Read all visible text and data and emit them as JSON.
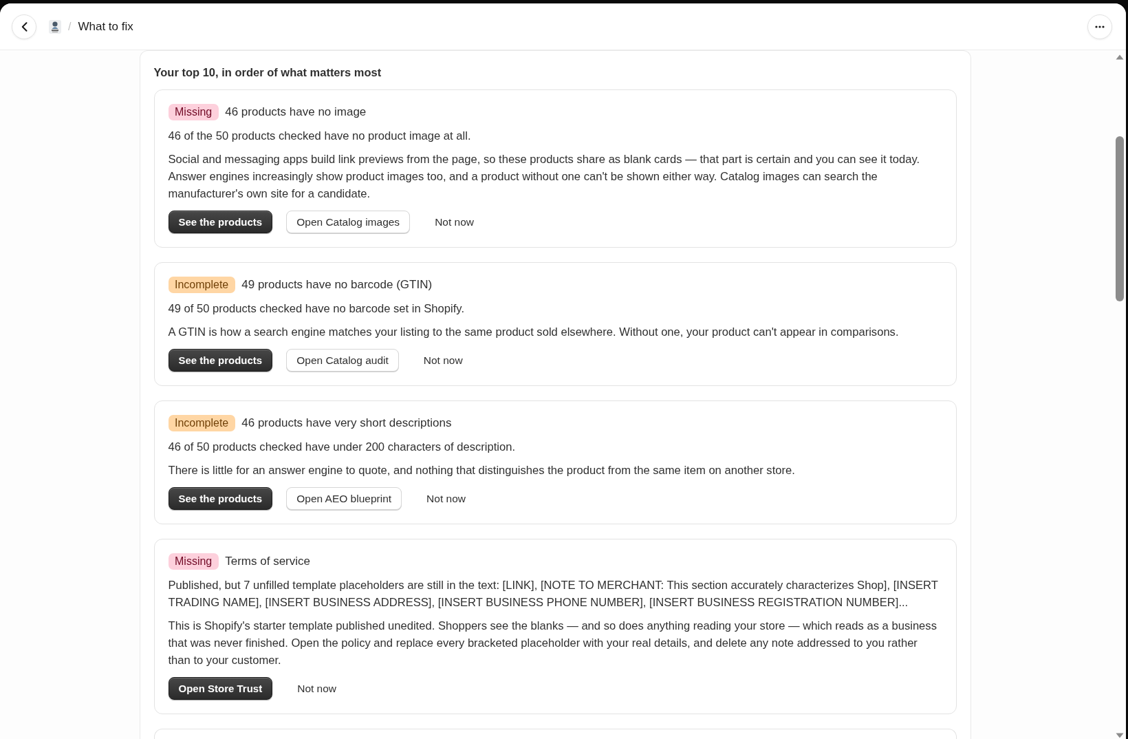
{
  "header": {
    "breadcrumb": {
      "separator": "/",
      "title": "What to fix"
    }
  },
  "panel": {
    "heading": "Your top 10, in order of what matters most",
    "issues": [
      {
        "badge": {
          "label": "Missing",
          "color": "#fdd0dc"
        },
        "title": "46 products have no image",
        "summary": "46 of the 50 products checked have no product image at all.",
        "detail": "Social and messaging apps build link previews from the page, so these products share as blank cards — that part is certain and you can see it today. Answer engines increasingly show product images too, and a product without one can't be shown either way. Catalog images can search the manufacturer's own site for a candidate.",
        "actions": [
          {
            "label": "See the products",
            "kind": "primary"
          },
          {
            "label": "Open Catalog images",
            "kind": "secondary"
          },
          {
            "label": "Not now",
            "kind": "plain"
          }
        ]
      },
      {
        "badge": {
          "label": "Incomplete",
          "color": "#ffd6a4"
        },
        "title": "49 products have no barcode (GTIN)",
        "summary": "49 of 50 products checked have no barcode set in Shopify.",
        "detail": "A GTIN is how a search engine matches your listing to the same product sold elsewhere. Without one, your product can't appear in comparisons.",
        "actions": [
          {
            "label": "See the products",
            "kind": "primary"
          },
          {
            "label": "Open Catalog audit",
            "kind": "secondary"
          },
          {
            "label": "Not now",
            "kind": "plain"
          }
        ]
      },
      {
        "badge": {
          "label": "Incomplete",
          "color": "#ffd6a4"
        },
        "title": "46 products have very short descriptions",
        "summary": "46 of 50 products checked have under 200 characters of description.",
        "detail": "There is little for an answer engine to quote, and nothing that distinguishes the product from the same item on another store.",
        "actions": [
          {
            "label": "See the products",
            "kind": "primary"
          },
          {
            "label": "Open AEO blueprint",
            "kind": "secondary"
          },
          {
            "label": "Not now",
            "kind": "plain"
          }
        ]
      },
      {
        "badge": {
          "label": "Missing",
          "color": "#fdd0dc"
        },
        "title": "Terms of service",
        "summary": "Published, but 7 unfilled template placeholders are still in the text: [LINK], [NOTE TO MERCHANT: This section accurately characterizes Shop], [INSERT TRADING NAME], [INSERT BUSINESS ADDRESS], [INSERT BUSINESS PHONE NUMBER], [INSERT BUSINESS REGISTRATION NUMBER]...",
        "detail": "This is Shopify's starter template published unedited. Shoppers see the blanks — and so does anything reading your store — which reads as a business that was never finished. Open the policy and replace every bracketed placeholder with your real details, and delete any note addressed to you rather than to your customer.",
        "actions": [
          {
            "label": "Open Store Trust",
            "kind": "primary"
          },
          {
            "label": "Not now",
            "kind": "plain"
          }
        ]
      }
    ]
  }
}
